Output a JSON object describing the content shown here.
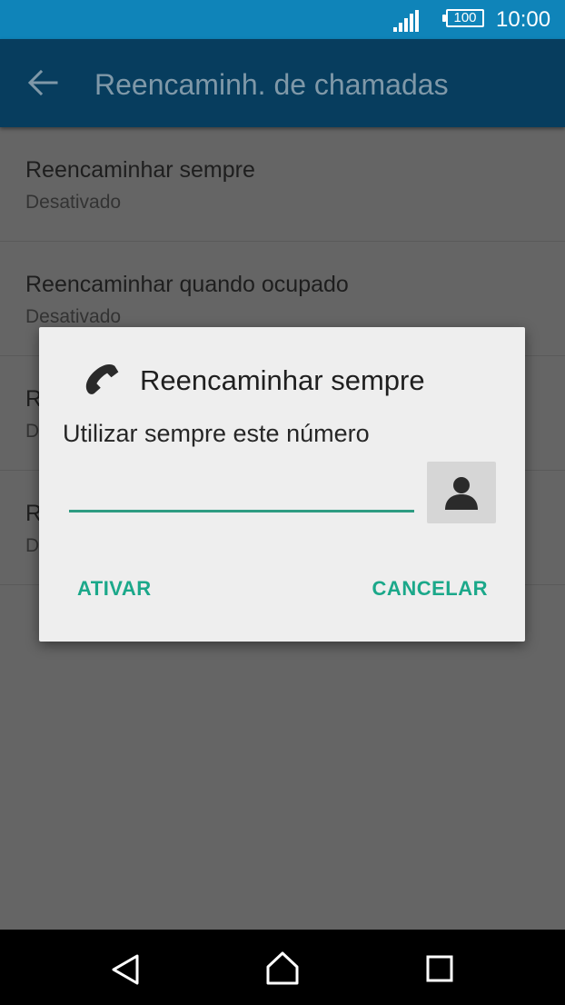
{
  "status_bar": {
    "battery_level": "100",
    "time": "10:00",
    "icons": [
      "signal-icon",
      "battery-icon"
    ]
  },
  "app_bar": {
    "title": "Reencaminh. de chamadas",
    "back_icon": "back-arrow-icon"
  },
  "list": {
    "items": [
      {
        "title": "Reencaminhar sempre",
        "subtitle": "Desativado"
      },
      {
        "title": "Reencaminhar quando ocupado",
        "subtitle": "Desativado"
      },
      {
        "title": "R",
        "subtitle": "D"
      },
      {
        "title": "R",
        "subtitle": "D"
      }
    ]
  },
  "dialog": {
    "icon": "phone-icon",
    "title": "Reencaminhar sempre",
    "message": "Utilizar sempre este número",
    "number_value": "",
    "contact_icon": "contact-person-icon",
    "confirm_label": "ATIVAR",
    "cancel_label": "CANCELAR"
  },
  "nav_bar": {
    "icons": [
      "nav-back-icon",
      "nav-home-icon",
      "nav-recent-icon"
    ]
  },
  "colors": {
    "status_bar": "#0f84b9",
    "app_bar": "#073d5e",
    "accent": "#1ba88a",
    "scrim_background": "#656565",
    "dialog_background": "#eeeeee"
  }
}
